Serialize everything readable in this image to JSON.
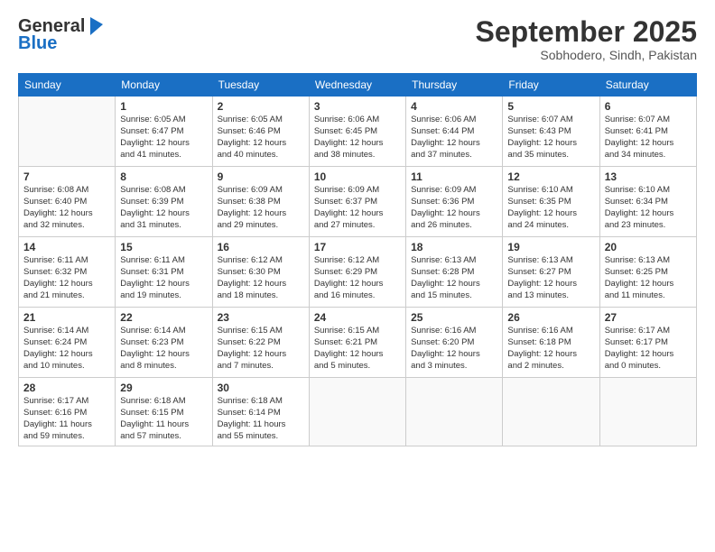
{
  "header": {
    "logo_line1": "General",
    "logo_line2": "Blue",
    "month": "September 2025",
    "location": "Sobhodero, Sindh, Pakistan"
  },
  "weekdays": [
    "Sunday",
    "Monday",
    "Tuesday",
    "Wednesday",
    "Thursday",
    "Friday",
    "Saturday"
  ],
  "weeks": [
    [
      {
        "day": "",
        "info": ""
      },
      {
        "day": "1",
        "info": "Sunrise: 6:05 AM\nSunset: 6:47 PM\nDaylight: 12 hours\nand 41 minutes."
      },
      {
        "day": "2",
        "info": "Sunrise: 6:05 AM\nSunset: 6:46 PM\nDaylight: 12 hours\nand 40 minutes."
      },
      {
        "day": "3",
        "info": "Sunrise: 6:06 AM\nSunset: 6:45 PM\nDaylight: 12 hours\nand 38 minutes."
      },
      {
        "day": "4",
        "info": "Sunrise: 6:06 AM\nSunset: 6:44 PM\nDaylight: 12 hours\nand 37 minutes."
      },
      {
        "day": "5",
        "info": "Sunrise: 6:07 AM\nSunset: 6:43 PM\nDaylight: 12 hours\nand 35 minutes."
      },
      {
        "day": "6",
        "info": "Sunrise: 6:07 AM\nSunset: 6:41 PM\nDaylight: 12 hours\nand 34 minutes."
      }
    ],
    [
      {
        "day": "7",
        "info": "Sunrise: 6:08 AM\nSunset: 6:40 PM\nDaylight: 12 hours\nand 32 minutes."
      },
      {
        "day": "8",
        "info": "Sunrise: 6:08 AM\nSunset: 6:39 PM\nDaylight: 12 hours\nand 31 minutes."
      },
      {
        "day": "9",
        "info": "Sunrise: 6:09 AM\nSunset: 6:38 PM\nDaylight: 12 hours\nand 29 minutes."
      },
      {
        "day": "10",
        "info": "Sunrise: 6:09 AM\nSunset: 6:37 PM\nDaylight: 12 hours\nand 27 minutes."
      },
      {
        "day": "11",
        "info": "Sunrise: 6:09 AM\nSunset: 6:36 PM\nDaylight: 12 hours\nand 26 minutes."
      },
      {
        "day": "12",
        "info": "Sunrise: 6:10 AM\nSunset: 6:35 PM\nDaylight: 12 hours\nand 24 minutes."
      },
      {
        "day": "13",
        "info": "Sunrise: 6:10 AM\nSunset: 6:34 PM\nDaylight: 12 hours\nand 23 minutes."
      }
    ],
    [
      {
        "day": "14",
        "info": "Sunrise: 6:11 AM\nSunset: 6:32 PM\nDaylight: 12 hours\nand 21 minutes."
      },
      {
        "day": "15",
        "info": "Sunrise: 6:11 AM\nSunset: 6:31 PM\nDaylight: 12 hours\nand 19 minutes."
      },
      {
        "day": "16",
        "info": "Sunrise: 6:12 AM\nSunset: 6:30 PM\nDaylight: 12 hours\nand 18 minutes."
      },
      {
        "day": "17",
        "info": "Sunrise: 6:12 AM\nSunset: 6:29 PM\nDaylight: 12 hours\nand 16 minutes."
      },
      {
        "day": "18",
        "info": "Sunrise: 6:13 AM\nSunset: 6:28 PM\nDaylight: 12 hours\nand 15 minutes."
      },
      {
        "day": "19",
        "info": "Sunrise: 6:13 AM\nSunset: 6:27 PM\nDaylight: 12 hours\nand 13 minutes."
      },
      {
        "day": "20",
        "info": "Sunrise: 6:13 AM\nSunset: 6:25 PM\nDaylight: 12 hours\nand 11 minutes."
      }
    ],
    [
      {
        "day": "21",
        "info": "Sunrise: 6:14 AM\nSunset: 6:24 PM\nDaylight: 12 hours\nand 10 minutes."
      },
      {
        "day": "22",
        "info": "Sunrise: 6:14 AM\nSunset: 6:23 PM\nDaylight: 12 hours\nand 8 minutes."
      },
      {
        "day": "23",
        "info": "Sunrise: 6:15 AM\nSunset: 6:22 PM\nDaylight: 12 hours\nand 7 minutes."
      },
      {
        "day": "24",
        "info": "Sunrise: 6:15 AM\nSunset: 6:21 PM\nDaylight: 12 hours\nand 5 minutes."
      },
      {
        "day": "25",
        "info": "Sunrise: 6:16 AM\nSunset: 6:20 PM\nDaylight: 12 hours\nand 3 minutes."
      },
      {
        "day": "26",
        "info": "Sunrise: 6:16 AM\nSunset: 6:18 PM\nDaylight: 12 hours\nand 2 minutes."
      },
      {
        "day": "27",
        "info": "Sunrise: 6:17 AM\nSunset: 6:17 PM\nDaylight: 12 hours\nand 0 minutes."
      }
    ],
    [
      {
        "day": "28",
        "info": "Sunrise: 6:17 AM\nSunset: 6:16 PM\nDaylight: 11 hours\nand 59 minutes."
      },
      {
        "day": "29",
        "info": "Sunrise: 6:18 AM\nSunset: 6:15 PM\nDaylight: 11 hours\nand 57 minutes."
      },
      {
        "day": "30",
        "info": "Sunrise: 6:18 AM\nSunset: 6:14 PM\nDaylight: 11 hours\nand 55 minutes."
      },
      {
        "day": "",
        "info": ""
      },
      {
        "day": "",
        "info": ""
      },
      {
        "day": "",
        "info": ""
      },
      {
        "day": "",
        "info": ""
      }
    ]
  ]
}
